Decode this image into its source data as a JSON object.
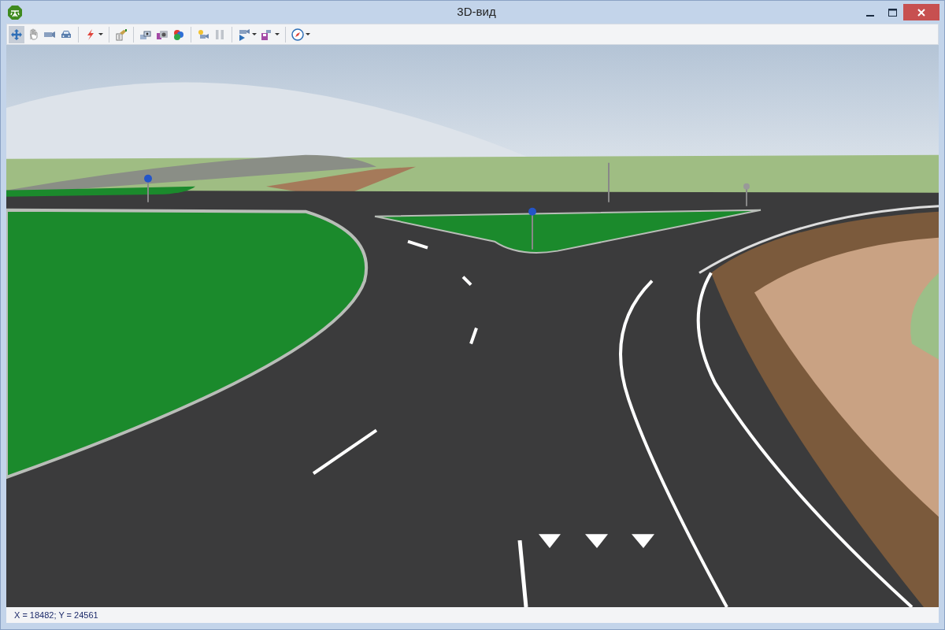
{
  "window": {
    "title": "3D-вид"
  },
  "toolbar": {
    "groups": [
      [
        {
          "kind": "button",
          "selected": true
        },
        {
          "kind": "button",
          "selected": false
        },
        {
          "kind": "button",
          "selected": false
        },
        {
          "kind": "button",
          "selected": false
        }
      ],
      [
        {
          "kind": "dropdown",
          "selected": false
        }
      ],
      [
        {
          "kind": "button",
          "selected": false
        }
      ],
      [
        {
          "kind": "button",
          "selected": false
        },
        {
          "kind": "button",
          "selected": false
        },
        {
          "kind": "button",
          "selected": false
        }
      ],
      [
        {
          "kind": "button",
          "selected": false
        },
        {
          "kind": "button",
          "selected": false
        }
      ],
      [
        {
          "kind": "dropdown",
          "selected": false
        },
        {
          "kind": "dropdown",
          "selected": false
        }
      ],
      [
        {
          "kind": "dropdown",
          "selected": false
        }
      ]
    ]
  },
  "status_bar": {
    "coordinates": "X = 18482; Y = 24561"
  }
}
